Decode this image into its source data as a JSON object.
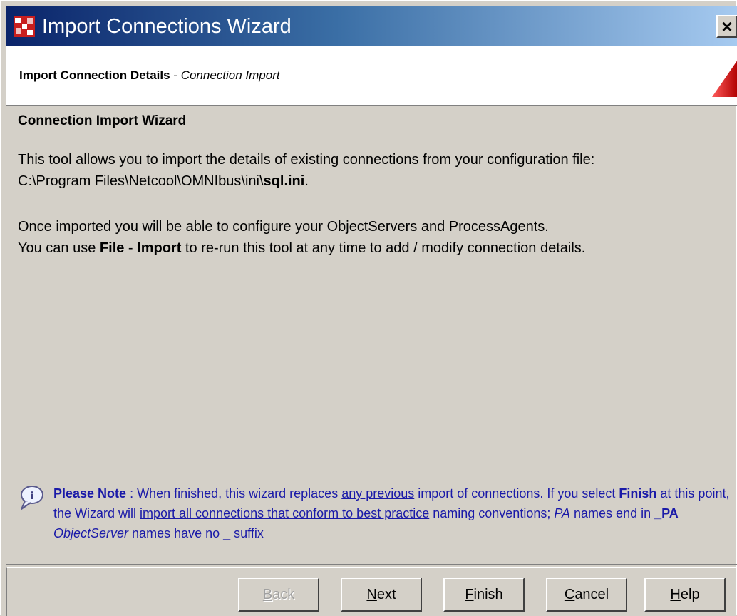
{
  "window": {
    "title": "Import Connections Wizard",
    "close_glyph": "×"
  },
  "header": {
    "title_bold": "Import Connection Details",
    "title_sep": " - ",
    "title_italic": "Connection Import"
  },
  "content": {
    "heading": "Connection Import Wizard",
    "p1_line1": "This tool allows you to import the details of existing connections from your configuration file:",
    "p1_path": "C:\\Program Files\\Netcool\\OMNIbus\\ini\\",
    "p1_file": "sql.ini",
    "p1_end": ".",
    "p2_line1": "Once imported you will be able to configure your ObjectServers and ProcessAgents.",
    "p2_pre": "You can use ",
    "p2_file": "File",
    "p2_sep": " - ",
    "p2_import": "Import",
    "p2_post": " to re-run this tool at any time to add / modify connection details."
  },
  "note": {
    "label": "Please Note",
    "t1": " : When finished, this wizard replaces ",
    "link1": "any previous",
    "t2": " import of connections. If you select ",
    "finish": "Finish",
    "t3": " at this point, the Wizard will ",
    "link2": "import all connections that conform to best practice",
    "t4": " naming conventions; ",
    "pa": "PA",
    "t5": " names end in ",
    "suffix": "_PA",
    "t6": " ",
    "os": "ObjectServer",
    "t7": " names have no _ suffix"
  },
  "buttons": {
    "back": {
      "acc": "B",
      "rest": "ack",
      "enabled": false
    },
    "next": {
      "acc": "N",
      "rest": "ext",
      "enabled": true
    },
    "finish": {
      "acc": "F",
      "rest": "inish",
      "enabled": true
    },
    "cancel": {
      "acc": "C",
      "rest": "ancel",
      "enabled": true
    },
    "help": {
      "acc": "H",
      "rest": "elp",
      "enabled": true
    }
  },
  "colors": {
    "titlebar_start": "#0a246a",
    "titlebar_end": "#a6caf0",
    "note_text": "#1a1aa8",
    "header_accent": "#e02020",
    "face": "#d4d0c8"
  },
  "icons": {
    "app": "import-wizard-app-icon",
    "close": "close-icon",
    "note": "info-balloon-icon",
    "header": "red-triangle-icon"
  }
}
